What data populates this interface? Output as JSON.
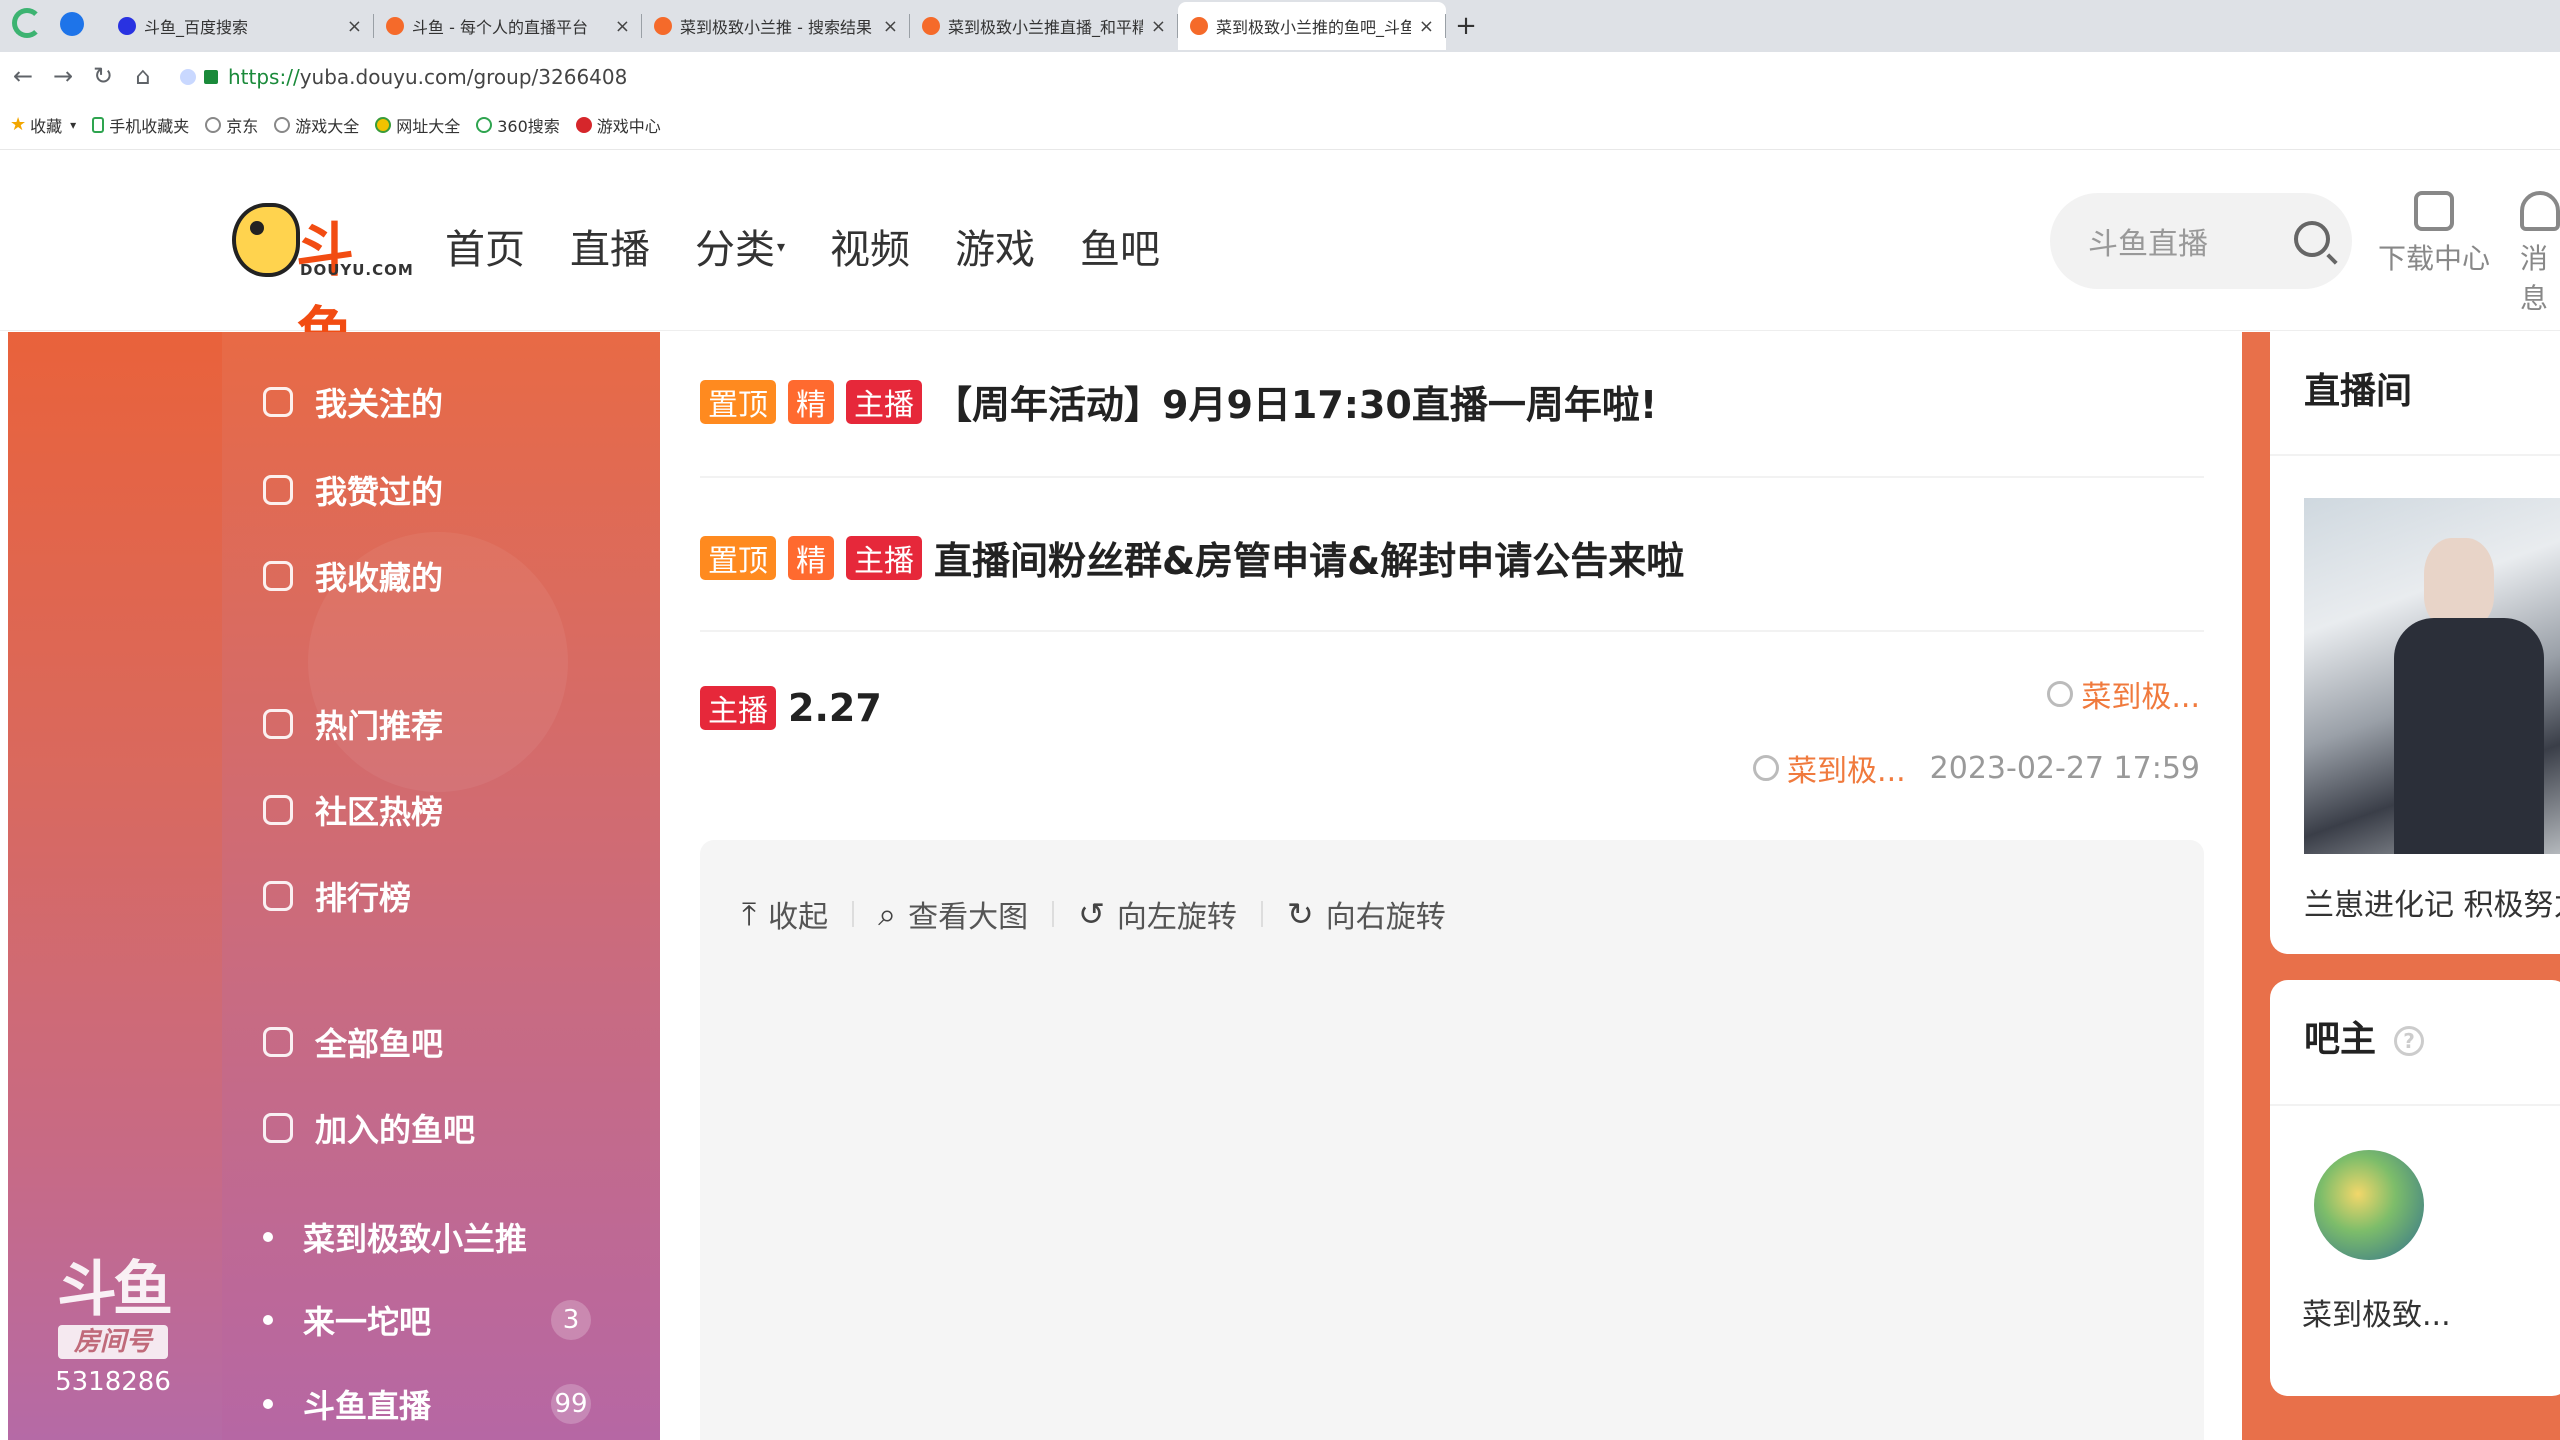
{
  "browser": {
    "tabs": [
      {
        "title": "斗鱼_百度搜索"
      },
      {
        "title": "斗鱼 - 每个人的直播平台"
      },
      {
        "title": "菜到极致小兰推 - 搜索结果 -"
      },
      {
        "title": "菜到极致小兰推直播_和平精英"
      },
      {
        "title": "菜到极致小兰推的鱼吧_斗鱼鱼"
      }
    ],
    "new_tab": "+",
    "url_scheme": "https://",
    "url_rest": "yuba.douyu.com/group/3266408",
    "bookmarks": [
      {
        "label": "收藏",
        "icon": "star-icon"
      },
      {
        "label": "手机收藏夹",
        "icon": "phone-icon"
      },
      {
        "label": "京东",
        "icon": "globe-icon"
      },
      {
        "label": "游戏大全",
        "icon": "globe-icon"
      },
      {
        "label": "网址大全",
        "icon": "nav-icon"
      },
      {
        "label": "360搜索",
        "icon": "search-icon"
      },
      {
        "label": "游戏中心",
        "icon": "game-icon"
      }
    ]
  },
  "header": {
    "logo_text": "斗鱼",
    "logo_sub": "DOUYU.COM",
    "nav": [
      "首页",
      "直播",
      "分类",
      "视频",
      "游戏",
      "鱼吧"
    ],
    "search_placeholder": "斗鱼直播",
    "download_label": "下载中心",
    "message_label": "消息"
  },
  "sidebar": {
    "items": [
      {
        "label": "我关注的",
        "icon": "crown-icon"
      },
      {
        "label": "我赞过的",
        "icon": "thumbs-up-icon"
      },
      {
        "label": "我收藏的",
        "icon": "star-icon"
      },
      {
        "label": "热门推荐",
        "icon": "flame-icon"
      },
      {
        "label": "社区热榜",
        "icon": "hot-list-icon"
      },
      {
        "label": "排行榜",
        "icon": "trophy-icon"
      },
      {
        "label": "全部鱼吧",
        "icon": "house-icon"
      },
      {
        "label": "加入的鱼吧",
        "icon": "joined-icon"
      }
    ],
    "groups": [
      {
        "label": "菜到极致小兰推",
        "count": ""
      },
      {
        "label": "来一坨吧",
        "count": "3"
      },
      {
        "label": "斗鱼直播",
        "count": "99"
      }
    ],
    "room_badge": {
      "logo": "斗鱼",
      "tag": "房间号",
      "number": "5318286"
    }
  },
  "posts": [
    {
      "tags": [
        "置顶",
        "精",
        "主播"
      ],
      "title": "【周年活动】9月9日17:30直播一周年啦!"
    },
    {
      "tags": [
        "置顶",
        "精",
        "主播"
      ],
      "title": "直播间粉丝群&房管申请&解封申请公告来啦"
    },
    {
      "tags": [
        "主播"
      ],
      "title": "2.27",
      "author": "菜到极...",
      "last_reply": "菜到极...",
      "time": "2023-02-27 17:59"
    }
  ],
  "image_tools": [
    {
      "label": "收起",
      "icon": "collapse-icon",
      "glyph": "⤒"
    },
    {
      "label": "查看大图",
      "icon": "zoom-icon",
      "glyph": "⌕"
    },
    {
      "label": "向左旋转",
      "icon": "rotate-left-icon",
      "glyph": "↺"
    },
    {
      "label": "向右旋转",
      "icon": "rotate-right-icon",
      "glyph": "↻"
    }
  ],
  "right": {
    "live_title": "直播间",
    "live_name": "兰崽进化记 积极努力",
    "owner_title": "吧主",
    "owner_name": "菜到极致..."
  }
}
